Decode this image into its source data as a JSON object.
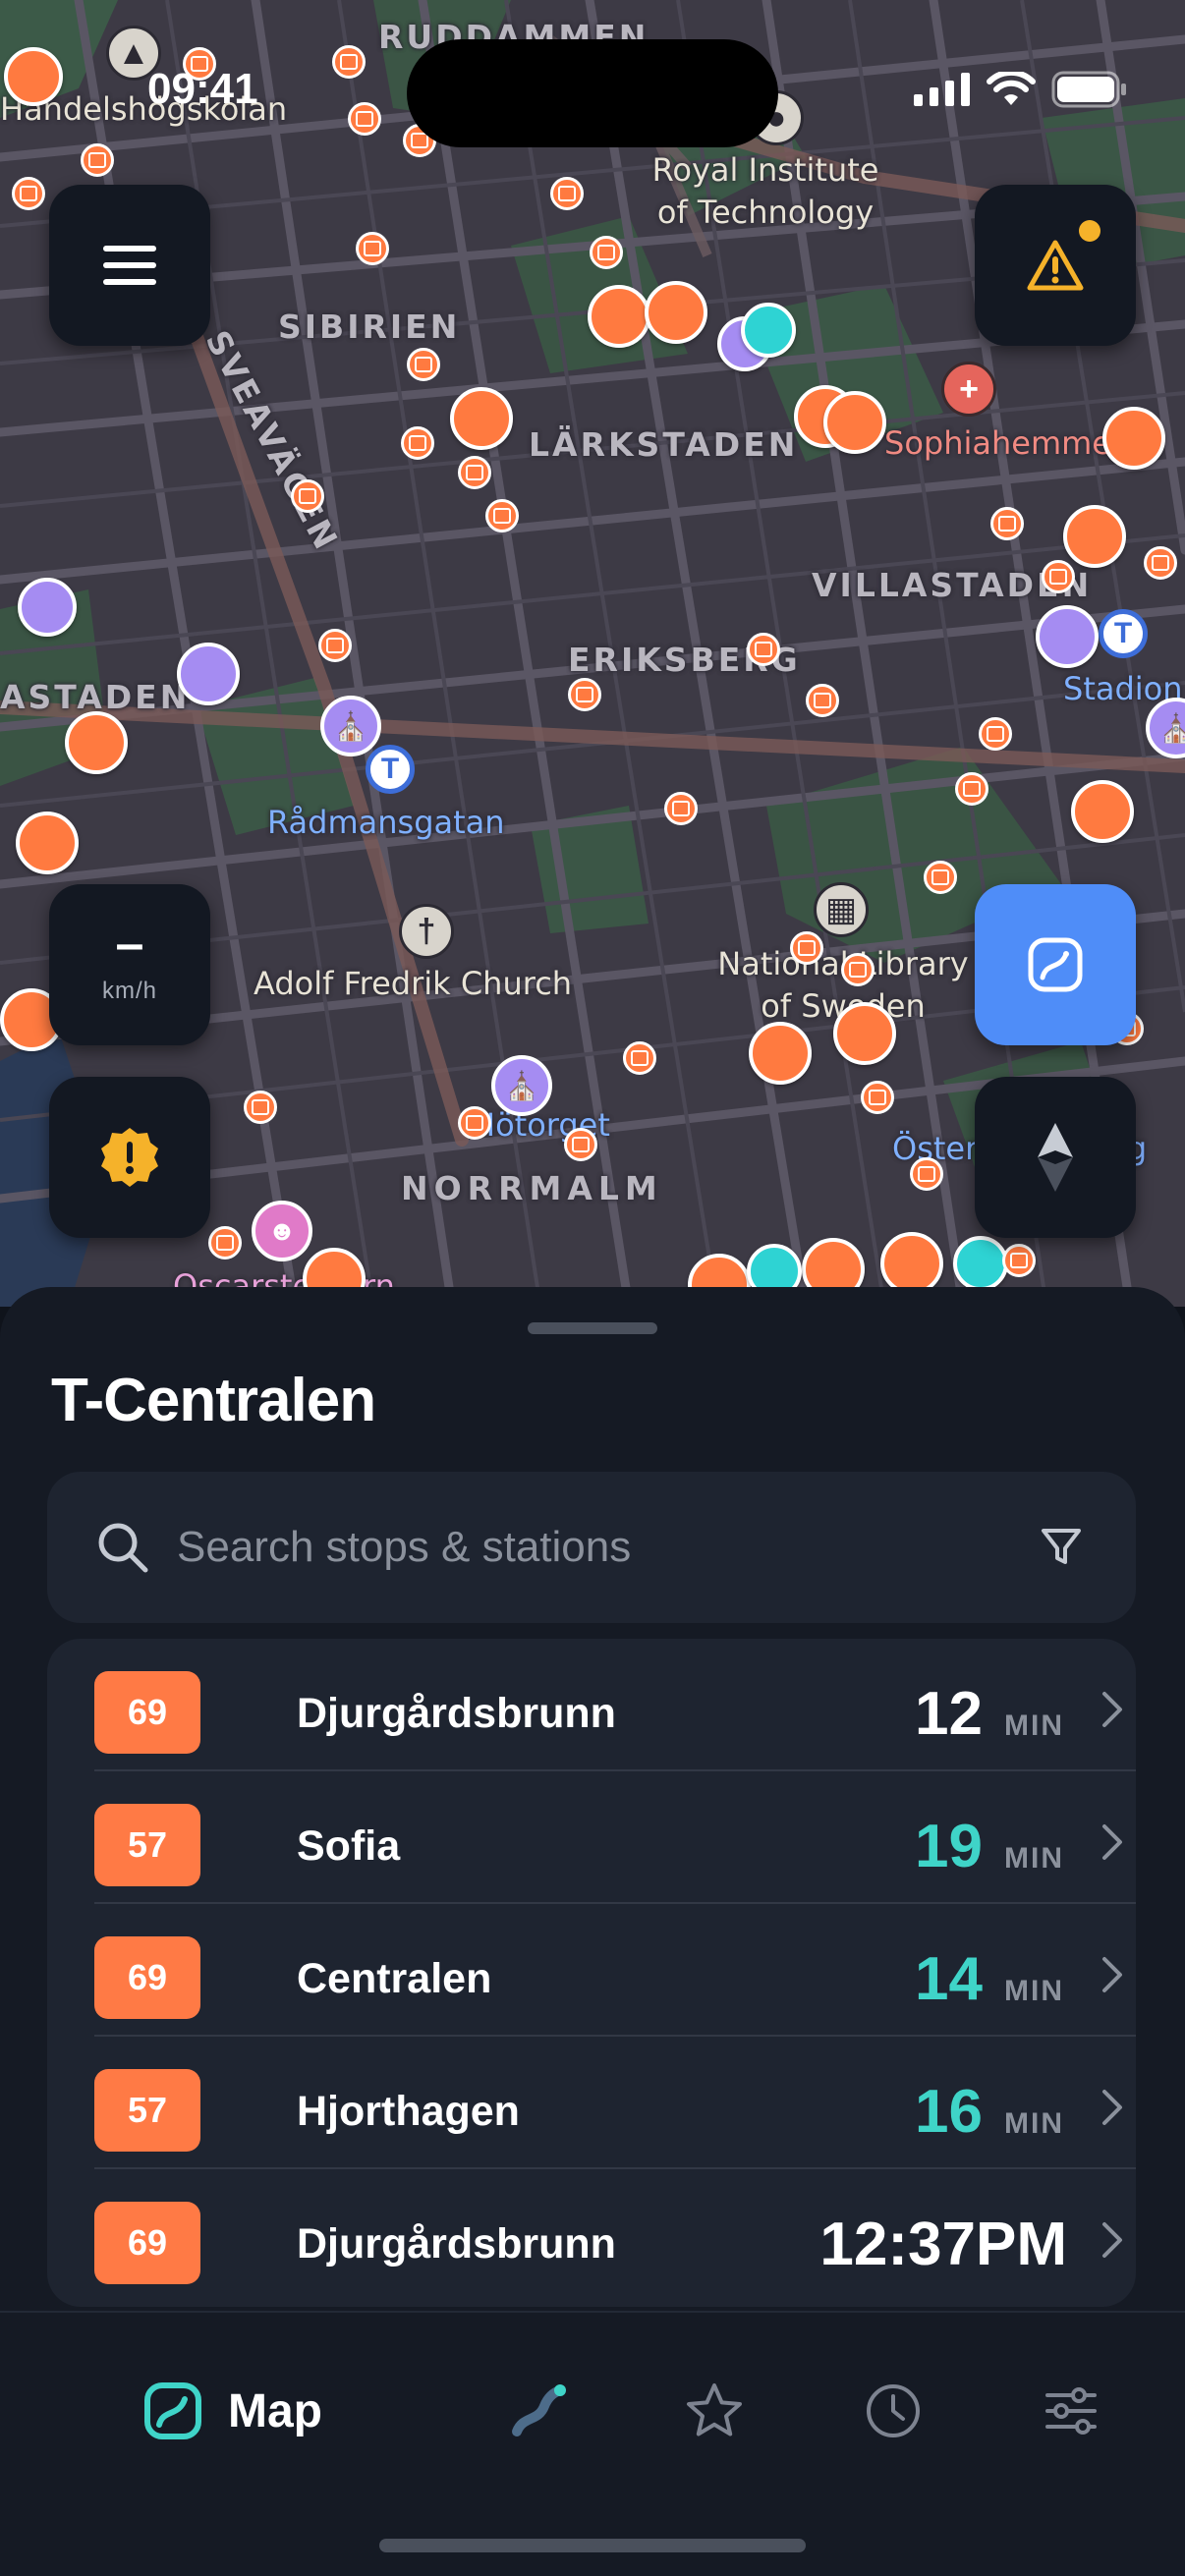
{
  "status_bar": {
    "time": "09:41"
  },
  "map": {
    "area_labels": [
      {
        "id": "sibirien",
        "text": "SIBIRIEN"
      },
      {
        "id": "larkstaden",
        "text": "LÄRKSTADEN"
      },
      {
        "id": "villastaden",
        "text": "VILLASTADEN"
      },
      {
        "id": "eriksberg",
        "text": "ERIKSBERG"
      },
      {
        "id": "vasastaden",
        "text": "ASTADEN"
      },
      {
        "id": "norrmalm",
        "text": "NORRMALM"
      },
      {
        "id": "ruddammen",
        "text": "RUDDAMMEN"
      },
      {
        "id": "sveavagen",
        "text": "SVEAVÄGEN"
      }
    ],
    "poi_labels": {
      "royal_institute": "Royal Institute of Technology",
      "radmansgatan": "Rådmansgatan",
      "adolf_fredrik": "Adolf Fredrik Church",
      "national_library": "National Library of Sweden",
      "sophiahemmet": "Sophiahemmet",
      "stadion": "Stadion",
      "hotorget": "Hötorget",
      "ostermalm": "Östermalmstorg",
      "oscarsteatern": "Oscarsteatern",
      "handelshogskolan": "Handelshögskolan"
    }
  },
  "controls": {
    "speed_value": "–",
    "speed_unit": "km/h"
  },
  "sheet": {
    "title": "T-Centralen",
    "search_placeholder": "Search stops & stations",
    "eta_unit": "MIN",
    "departures": [
      {
        "route": "69",
        "destination": "Djurgårdsbrunn",
        "eta": "12",
        "unit": "MIN",
        "live": false
      },
      {
        "route": "57",
        "destination": "Sofia",
        "eta": "19",
        "unit": "MIN",
        "live": true
      },
      {
        "route": "69",
        "destination": "Centralen",
        "eta": "14",
        "unit": "MIN",
        "live": true
      },
      {
        "route": "57",
        "destination": "Hjorthagen",
        "eta": "16",
        "unit": "MIN",
        "live": true
      },
      {
        "route": "69",
        "destination": "Djurgårdsbrunn",
        "eta": "12:37PM",
        "unit": "",
        "live": false
      }
    ]
  },
  "tabbar": {
    "map_label": "Map",
    "icons": [
      "map-icon",
      "route-icon",
      "star-icon",
      "clock-icon",
      "sliders-icon"
    ]
  },
  "colors": {
    "accent_orange": "#ff7a45",
    "accent_teal": "#3fd4c8",
    "accent_blue": "#4f8df8",
    "sheet_bg": "#151a24",
    "card_bg": "#1e2430"
  }
}
